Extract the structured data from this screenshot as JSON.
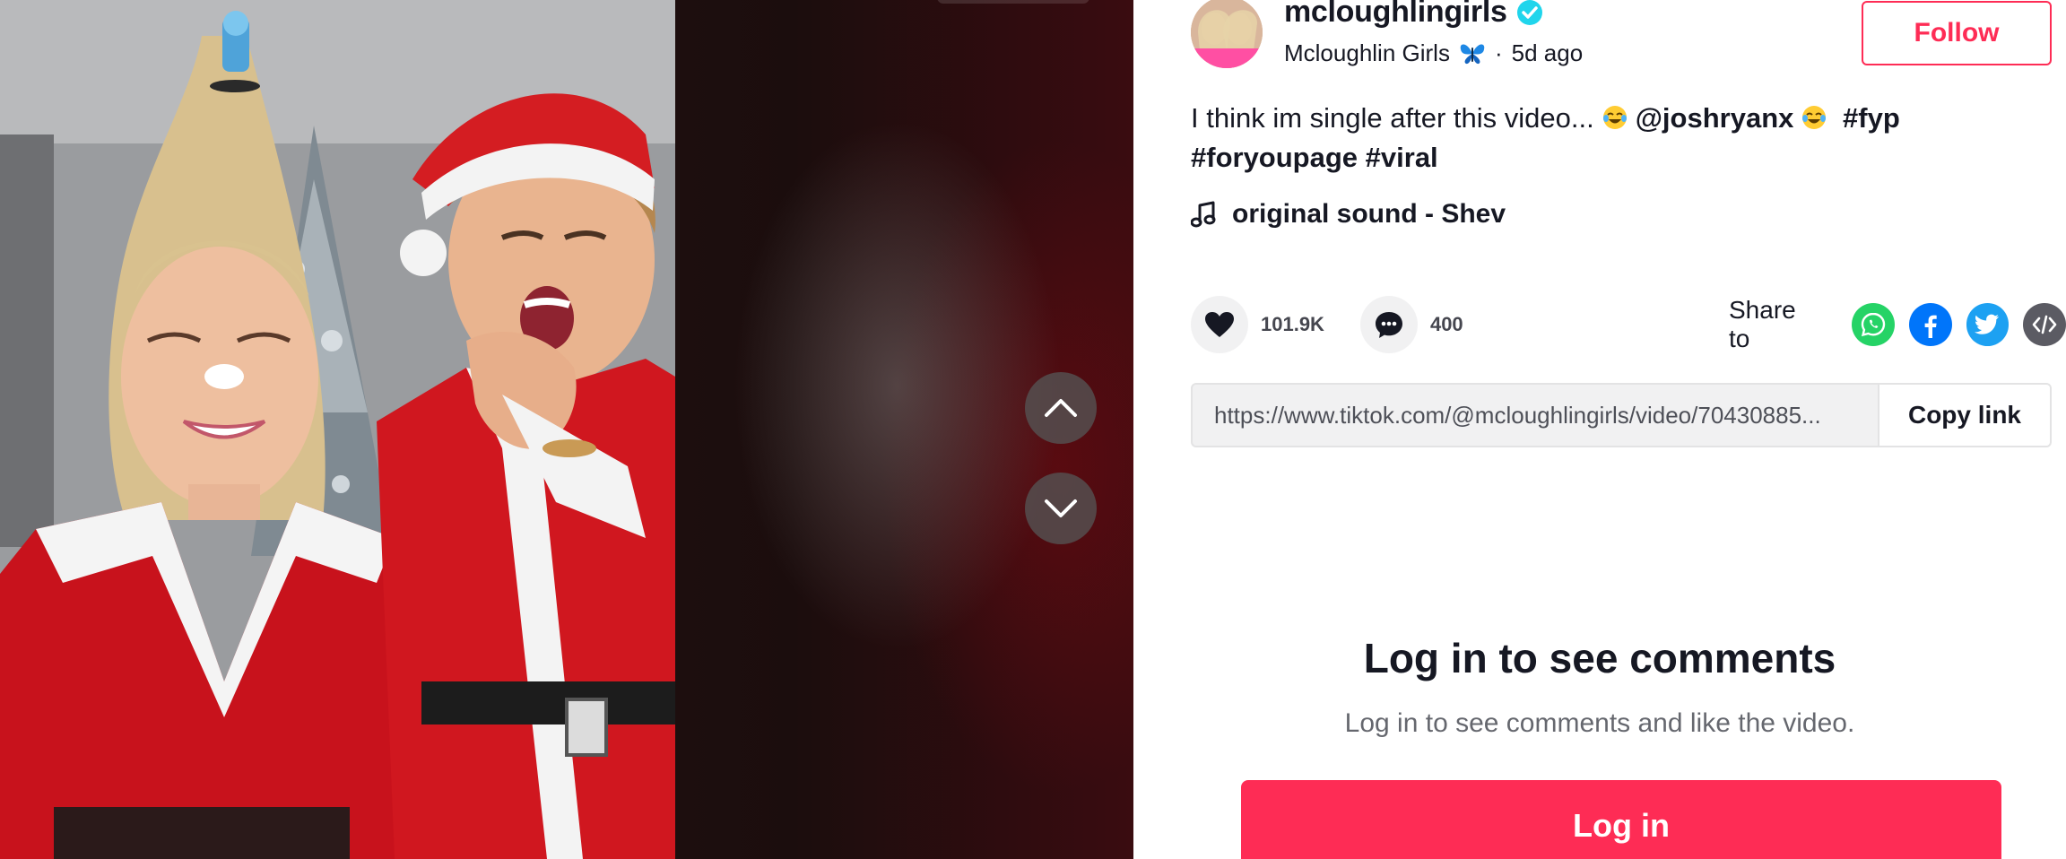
{
  "post": {
    "username": "mcloughlingirls",
    "display_name": "Mcloughlin Girls",
    "separator": "·",
    "time_ago": "5d ago",
    "follow_label": "Follow",
    "caption_text": "I think im single after this video...",
    "mention": "@joshryanx",
    "hashtags": [
      "#fyp",
      "#foryoupage",
      "#viral"
    ],
    "music": "original sound - Shev"
  },
  "actions": {
    "likes": "101.9K",
    "comments": "400",
    "share_label": "Share to",
    "share_targets": [
      "whatsapp-icon",
      "facebook-icon",
      "twitter-icon",
      "embed-icon"
    ]
  },
  "link": {
    "url": "https://www.tiktok.com/@mcloughlingirls/video/70430885...",
    "copy_label": "Copy link"
  },
  "comments_gate": {
    "title": "Log in to see comments",
    "subtitle": "Log in to see comments and like the video.",
    "login_label": "Log in"
  },
  "colors": {
    "brand": "#fe2c55",
    "verified": "#20d5ec",
    "whatsapp": "#25d366",
    "facebook": "#0075fa",
    "twitter": "#1da1f2",
    "embed": "#5b5b63"
  }
}
